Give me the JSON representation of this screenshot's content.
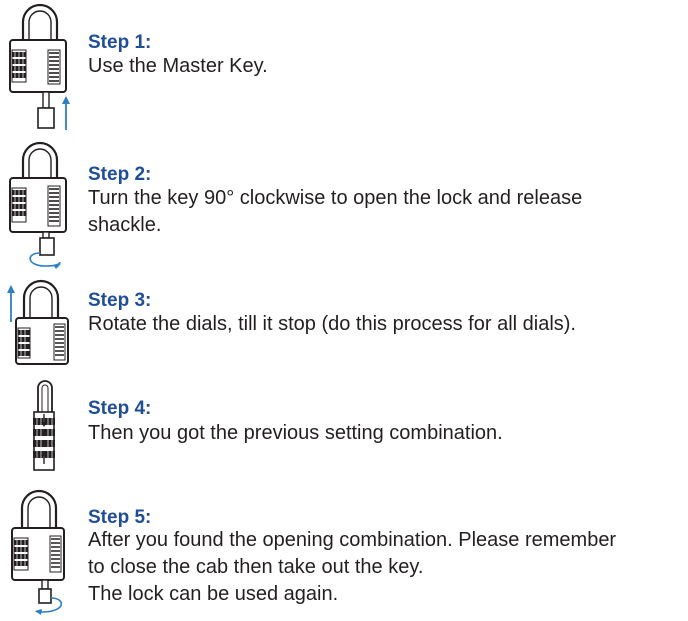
{
  "colors": {
    "title": "#1f4e96",
    "text": "#231f20",
    "arrow": "#2c7fc1",
    "line": "#231f20"
  },
  "icons": [
    "padlock-master-key-insert-icon",
    "padlock-turn-key-icon",
    "padlock-open-shackle-icon",
    "combination-dials-icon",
    "padlock-closed-turn-key-icon"
  ],
  "steps": [
    {
      "title": "Step 1:",
      "lines": [
        "Use the Master Key."
      ]
    },
    {
      "title": "Step 2:",
      "lines": [
        "Turn the key 90° clockwise to open the lock and release",
        "shackle."
      ]
    },
    {
      "title": "Step 3:",
      "lines": [
        "Rotate the dials, till it stop (do this process for all dials)."
      ]
    },
    {
      "title": "Step 4:",
      "lines": [
        "Then you got the previous setting combination."
      ]
    },
    {
      "title": "Step 5:",
      "lines": [
        "After you found the opening combination. Please remember",
        "to close the cab then take out the key.",
        "The lock can be used again."
      ]
    }
  ]
}
